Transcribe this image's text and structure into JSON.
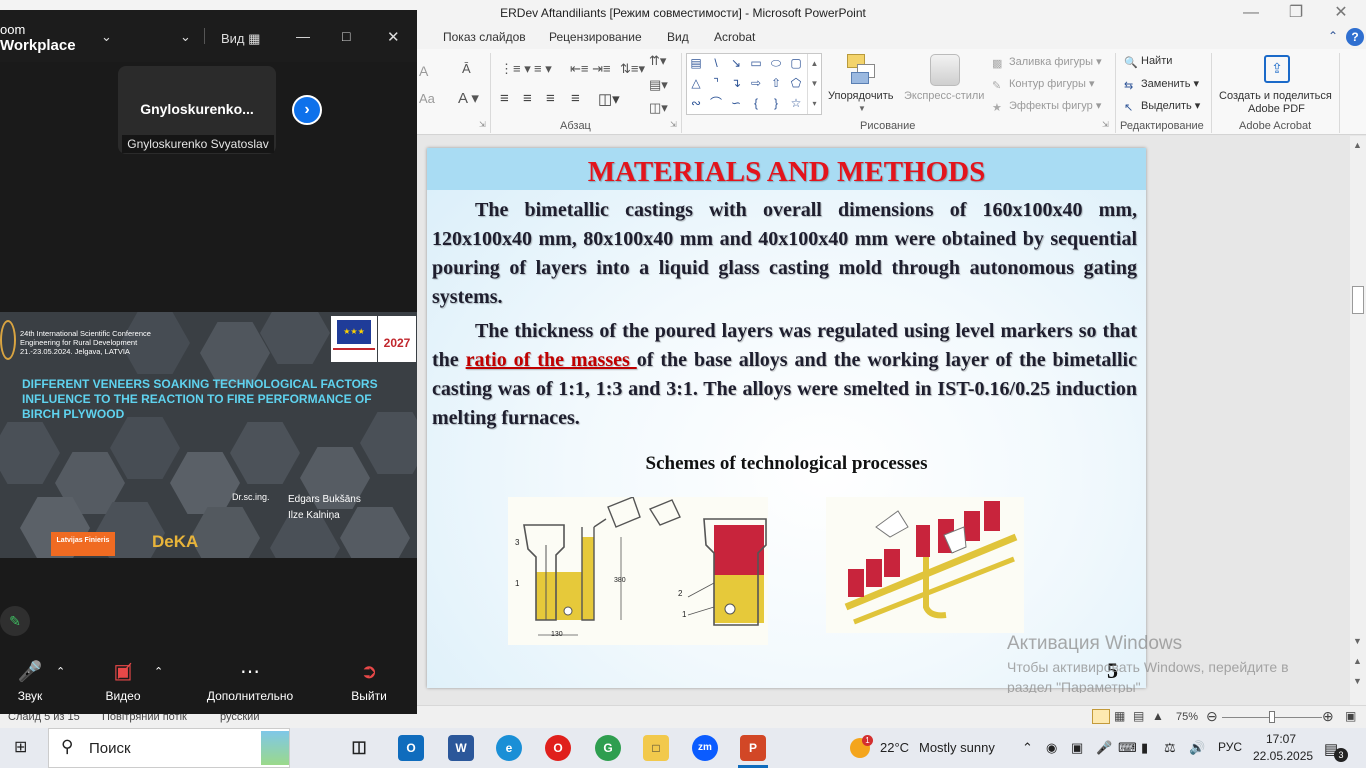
{
  "powerpoint": {
    "title": "ERDev Aftandiliants [Режим совместимости]  -  Microsoft PowerPoint",
    "tabs": [
      "Показ слайдов",
      "Рецензирование",
      "Вид",
      "Acrobat"
    ],
    "ribbon": {
      "groups": {
        "paragraph": "Абзац",
        "drawing": "Рисование",
        "editing": "Редактирование",
        "acrobat": "Adobe Acrobat"
      },
      "arrange": "Упорядочить",
      "quick_styles": "Экспресс-стили",
      "shape_fill": "Заливка фигуры",
      "shape_outline": "Контур фигуры",
      "shape_effects": "Эффекты фигур",
      "find": "Найти",
      "replace": "Заменить",
      "select": "Выделить",
      "create_share_pdf_1": "Создать и поделиться",
      "create_share_pdf_2": "Adobe PDF"
    },
    "status": {
      "slide": "Слайд 5 из 15",
      "theme": "Повітряний потік",
      "language": "русский",
      "zoom": "75%",
      "zoom_level": 0.5
    }
  },
  "slide": {
    "title": "MATERIALS AND METHODS",
    "para1": "The bimetallic castings with overall dimensions of 160x100x40 mm, 120x100x40 mm, 80x100x40 mm and 40x100x40 mm were obtained by sequential pouring of layers into a liquid glass casting mold through autonomous gating systems.",
    "para2_a": "The thickness of the poured layers was regulated using level markers so that the ",
    "para2_link": "ratio of the masses ",
    "para2_b": "of the base alloys and the working layer of the bimetallic casting was of 1:1, 1:3 and 3:1. The alloys were smelted in IST-0.16/0.25 induction melting furnaces.",
    "schemes_title": "Schemes of technological processes",
    "page_number": "5",
    "scheme_labels": [
      "3",
      "1",
      "2",
      "1",
      "130",
      "380"
    ]
  },
  "watermark": {
    "line1": "Активация Windows",
    "line2": "Чтобы активировать Windows, перейдите в раздел \"Параметры\""
  },
  "zoom": {
    "brand_line1": "oom",
    "brand_line2": "Workplace",
    "view_label": "Вид",
    "participant_name_short": "Gnyloskurenko...",
    "participant_name_full": "Gnyloskurenko Svyatoslav",
    "shared": {
      "conference": "24th International Scientific Conference",
      "conference_2": "Engineering for Rural Development",
      "conference_3": "21.-23.05.2024. Jelgava, LATVIA",
      "title": "DIFFERENT VENEERS SOAKING TECHNOLOGICAL FACTORS INFLUENCE TO THE REACTION TO FIRE PERFORMANCE OF BIRCH PLYWOOD",
      "degree": "Dr.sc.ing.",
      "author1": "Edgars Bukšāns",
      "author2": "Ilze Kalniņa",
      "logo_year": "2027",
      "logo_latvijas": "Latvijas Finieris",
      "logo_deka": "DeKA"
    },
    "controls": [
      "Звук",
      "Видео",
      "Дополнительно",
      "Выйти"
    ]
  },
  "taskbar": {
    "search": "Поиск",
    "weather_temp": "22°C",
    "weather_desc": "Mostly sunny",
    "weather_badge": "1",
    "lang": "РУС",
    "time": "17:07",
    "date": "22.05.2025",
    "notif_count": "3"
  },
  "colors": {
    "slide_title": "#e3141c",
    "banner": "#a9dcf3",
    "zoom_blue": "#0e71eb",
    "share_title": "#5fd3ef"
  }
}
